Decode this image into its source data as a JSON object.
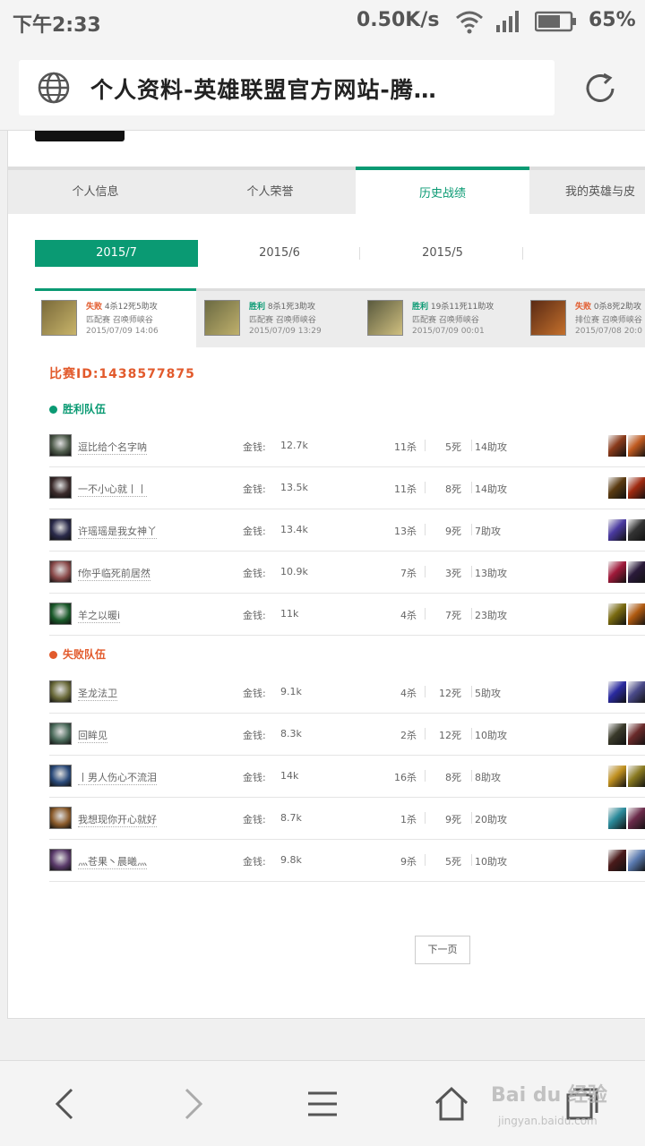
{
  "status_bar": {
    "time": "下午2:33",
    "speed": "0.50K/s",
    "battery": "65%",
    "icons": [
      "wifi-icon",
      "signal-icon",
      "battery-icon"
    ]
  },
  "browser": {
    "title": "个人资料-英雄联盟官方网站-腾…",
    "icons": [
      "globe-icon",
      "reload-icon"
    ]
  },
  "tabs": [
    "个人信息",
    "个人荣誉",
    "历史战绩",
    "我的英雄与皮"
  ],
  "active_tab": "历史战绩",
  "months": [
    "2015/7",
    "2015/6",
    "2015/5"
  ],
  "matches": [
    {
      "result": "失败",
      "win": false,
      "kda": "4杀12死5助攻",
      "mode": "匹配赛",
      "map": "召唤师峡谷",
      "time": "2015/07/09 14:06",
      "colors": [
        "#7a6a3a",
        "#c8b46a"
      ]
    },
    {
      "result": "胜利",
      "win": true,
      "kda": "8杀1死3助攻",
      "mode": "匹配赛",
      "map": "召唤师峡谷",
      "time": "2015/07/09 13:29",
      "colors": [
        "#6b6a42",
        "#bfb06c"
      ]
    },
    {
      "result": "胜利",
      "win": true,
      "kda": "19杀11死11助攻",
      "mode": "匹配赛",
      "map": "召唤师峡谷",
      "time": "2015/07/09 00:01",
      "colors": [
        "#5a5a3e",
        "#d0c080"
      ]
    },
    {
      "result": "失败",
      "win": false,
      "kda": "0杀8死2助攻",
      "mode": "排位赛",
      "map": "召唤师峡谷",
      "time": "2015/07/08 20:0",
      "colors": [
        "#5a2a14",
        "#c4702c"
      ]
    }
  ],
  "match_id": "比赛ID:1438577875",
  "gold_label": "金钱:",
  "win_team": {
    "title": "胜利队伍",
    "players": [
      {
        "name": "逗比给个名字呐",
        "gold": "12.7k",
        "kills": "11杀",
        "deaths": "5死",
        "assists": "14助攻",
        "avatar": "#4d5a4a",
        "items": [
          "#8a3a1a",
          "#c05a20"
        ]
      },
      {
        "name": "一不小心就丨丨",
        "gold": "13.5k",
        "kills": "11杀",
        "deaths": "8死",
        "assists": "14助攻",
        "avatar": "#3a2a2a",
        "items": [
          "#5a3a10",
          "#a02a10"
        ]
      },
      {
        "name": "许瑶瑶是我女神丫",
        "gold": "13.4k",
        "kills": "13杀",
        "deaths": "9死",
        "assists": "7助攻",
        "avatar": "#2a2a4a",
        "items": [
          "#4a3aa0",
          "#333333"
        ]
      },
      {
        "name": "f你乎临死前居然",
        "gold": "10.9k",
        "kills": "7杀",
        "deaths": "3死",
        "assists": "13助攻",
        "avatar": "#8a4a4a",
        "items": [
          "#a01a3a",
          "#2a1a3a"
        ]
      },
      {
        "name": "羊之以暖i",
        "gold": "11k",
        "kills": "4杀",
        "deaths": "7死",
        "assists": "23助攻",
        "avatar": "#1a5a2a",
        "items": [
          "#7a6a10",
          "#b05a10"
        ]
      }
    ]
  },
  "lose_team": {
    "title": "失败队伍",
    "players": [
      {
        "name": "圣龙法卫",
        "gold": "9.1k",
        "kills": "4杀",
        "deaths": "12死",
        "assists": "5助攻",
        "avatar": "#6a6a3a",
        "items": [
          "#2a2aa0",
          "#4a4a8a"
        ]
      },
      {
        "name": "回眸见",
        "gold": "8.3k",
        "kills": "2杀",
        "deaths": "12死",
        "assists": "10助攻",
        "avatar": "#4a6a5a",
        "items": [
          "#3a3a2a",
          "#6a2a2a"
        ]
      },
      {
        "name": "丨男人伤心不流泪",
        "gold": "14k",
        "kills": "16杀",
        "deaths": "8死",
        "assists": "8助攻",
        "avatar": "#2a4a7a",
        "items": [
          "#c09020",
          "#8a7a20"
        ]
      },
      {
        "name": "我想现你开心就好",
        "gold": "8.7k",
        "kills": "1杀",
        "deaths": "9死",
        "assists": "20助攻",
        "avatar": "#8a5a2a",
        "items": [
          "#2a8a9a",
          "#6a2a4a"
        ]
      },
      {
        "name": "灬苍果丶晨曦灬",
        "gold": "9.8k",
        "kills": "9杀",
        "deaths": "5死",
        "assists": "10助攻",
        "avatar": "#5a3a6a",
        "items": [
          "#4a1a1a",
          "#5a7ab0"
        ]
      }
    ]
  },
  "next_page": "下一页",
  "nav": {
    "icons": [
      "back-icon",
      "forward-icon",
      "menu-icon",
      "home-icon",
      "tabs-icon"
    ]
  },
  "watermark": {
    "logo": "Bai du 经验",
    "url": "jingyan.baidu.com"
  }
}
